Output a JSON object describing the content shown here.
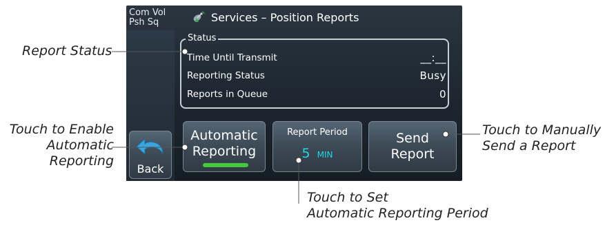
{
  "screen": {
    "volume_label": "Com Vol\nPsh Sq",
    "title": "Services – Position Reports",
    "title_icon": "satellite-dish-icon",
    "status": {
      "legend": "Status",
      "rows": [
        {
          "label": "Time Until Transmit",
          "value": "__:__"
        },
        {
          "label": "Reporting Status",
          "value": "Busy"
        },
        {
          "label": "Reports in Queue",
          "value": "0"
        }
      ]
    },
    "buttons": {
      "back": "Back",
      "automatic": "Automatic\nReporting",
      "period_label": "Report Period",
      "period_value": "5",
      "period_unit": "MIN",
      "send": "Send\nReport"
    },
    "colors": {
      "accent_cyan": "#21d8e6",
      "active_green": "#46c83a"
    }
  },
  "callouts": {
    "report_status": "Report Status",
    "enable_auto": "Touch to Enable\nAutomatic\nReporting",
    "manual_send": "Touch to Manually\nSend a Report",
    "set_period": "Touch to Set\n Automatic Reporting Period"
  }
}
